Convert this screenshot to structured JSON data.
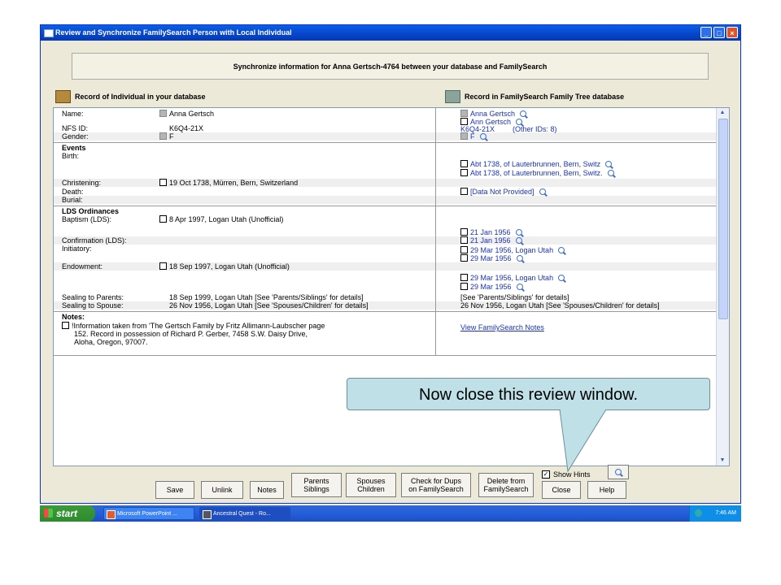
{
  "window": {
    "title": "Review and Synchronize FamilySearch Person with Local Individual",
    "controls": {
      "minimize": "_",
      "maximize": "□",
      "close": "×"
    }
  },
  "header": "Synchronize information for Anna Gertsch-4764 between your database and FamilySearch",
  "left_section_title": "Record of Individual in your database",
  "right_section_title": "Record in FamilySearch Family Tree database",
  "rows": {
    "name_label": "Name:",
    "name_left": "Anna Gertsch",
    "name_right_1": "Anna Gertsch",
    "name_right_2": "Ann Gertsch",
    "nfs_label": "NFS ID:",
    "nfs_left": "K6Q4-21X",
    "nfs_right": "K6Q4-21X",
    "nfs_right_other": "(Other IDs: 8)",
    "gender_label": "Gender:",
    "gender_left": "F",
    "gender_right": "F",
    "events_heading": "Events",
    "birth_label": "Birth:",
    "birth_right_1": "Abt 1738, of Lauterbrunnen, Bern, Switz",
    "birth_right_2": "Abt 1738, of Lauterbrunnen, Bern, Switz.",
    "christening_label": "Christening:",
    "christening_left": "19 Oct 1738, Mürren, Bern, Switzerland",
    "death_label": "Death:",
    "death_right": "[Data Not Provided]",
    "burial_label": "Burial:",
    "lds_heading": "LDS Ordinances",
    "baptism_label": "Baptism (LDS):",
    "baptism_left": "8 Apr 1997, Logan Utah (Unofficial)",
    "baptism_right": "21 Jan 1956",
    "confirmation_label": "Confirmation (LDS):",
    "confirmation_right": "21 Jan 1956",
    "initiatory_label": "Initiatory:",
    "initiatory_right_1": "29 Mar 1956, Logan Utah",
    "initiatory_right_2": "29 Mar 1956",
    "endowment_label": "Endowment:",
    "endowment_left": "18 Sep 1997, Logan Utah (Unofficial)",
    "endowment_right_1": "29 Mar 1956, Logan Utah",
    "endowment_right_2": "29 Mar 1956",
    "sealing_parents_label": "Sealing to Parents:",
    "sealing_parents_left": "18 Sep 1999, Logan Utah [See 'Parents/Siblings' for details]",
    "sealing_parents_right": "[See 'Parents/Siblings' for details]",
    "sealing_spouse_label": "Sealing to Spouse:",
    "sealing_spouse_left": "26 Nov 1956, Logan Utah [See 'Spouses/Children' for details]",
    "sealing_spouse_right": "26 Nov 1956, Logan Utah [See 'Spouses/Children' for details]",
    "notes_heading": "Notes:",
    "notes_line1": "!Information taken from 'The Gertsch Family by Fritz Allimann-Laubscher page",
    "notes_line2": "152.  Record in possession of Richard P. Gerber, 7458 S.W. Daisy Drive,",
    "notes_line3": "Aloha, Oregon, 97007.",
    "notes_link": "View FamilySearch Notes"
  },
  "buttons": {
    "save": "Save",
    "unlink": "Unlink",
    "notes": "Notes",
    "parents_1": "Parents",
    "parents_2": "Siblings",
    "spouses_1": "Spouses",
    "spouses_2": "Children",
    "dups_1": "Check for Dups",
    "dups_2": "on FamilySearch",
    "delete_1": "Delete from",
    "delete_2": "FamilySearch",
    "close": "Close",
    "help": "Help"
  },
  "show_hints": {
    "label": "Show Hints",
    "checked": true,
    "check_glyph": "✓"
  },
  "callout": "Now close this review window.",
  "taskbar": {
    "start": "start",
    "task1": "Microsoft PowerPoint ...",
    "task2": "Ancestral Quest - Ro...",
    "clock": "7:46 AM"
  },
  "colors": {
    "title_bar": "#0a5ee9",
    "link": "#1a33b3",
    "callout": "#bfe0e6",
    "start": "#3c9a3c"
  }
}
